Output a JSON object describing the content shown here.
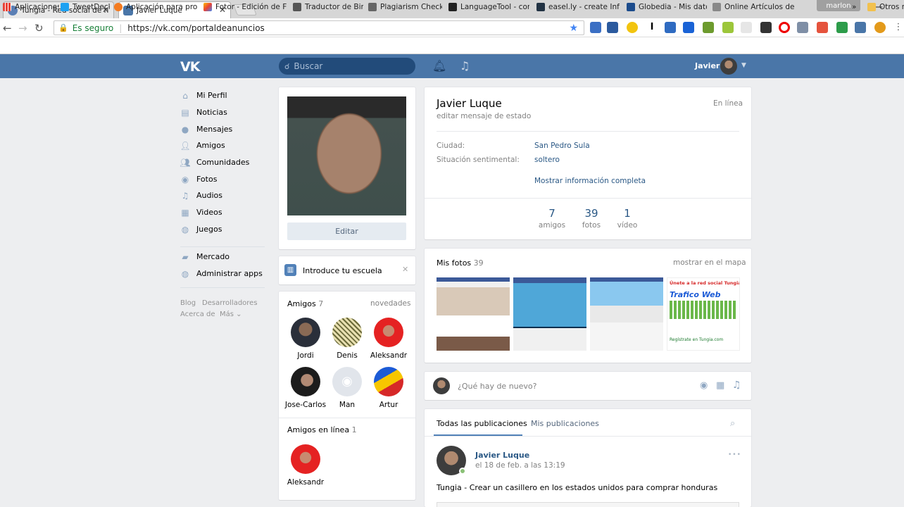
{
  "browser": {
    "tabs": [
      {
        "title": "Tungia - Red social de n",
        "close": "✕"
      },
      {
        "title": "Javier Luque",
        "close": "✕"
      }
    ],
    "user_badge": "marlon",
    "window_min": "—",
    "window_close": "✕",
    "secure_label": "Es seguro",
    "url": "https://vk.com/portaldeanuncios",
    "bookmarks": [
      "Aplicaciones",
      "TweetDeck",
      "Aplicación para progr",
      "Fotor - Edición de Fot",
      "Traductor de Bing",
      "Plagiarism Checker",
      "LanguageTool - corre",
      "easel.ly - create Infog",
      "Globedia - Mis datos",
      "Online Artículos de N"
    ],
    "bookmarks_more": "»",
    "other_bookmarks": "Otros m"
  },
  "vk": {
    "search_placeholder": "Buscar",
    "header_name": "Javier",
    "menu": [
      "Mi Perfil",
      "Noticias",
      "Mensajes",
      "Amigos",
      "Comunidades",
      "Fotos",
      "Audios",
      "Videos",
      "Juegos"
    ],
    "menu2": [
      "Mercado",
      "Administrar apps"
    ],
    "footer": [
      "Blog",
      "Desarrolladores",
      "Acerca de",
      "Más"
    ],
    "edit_button": "Editar",
    "school_prompt": "Introduce tu escuela",
    "friends_label": "Amigos",
    "friends_count": "7",
    "friends_updates": "novedades",
    "friends": [
      "Jordi",
      "Denis",
      "Aleksandr",
      "Jose-Carlos",
      "Man",
      "Artur"
    ],
    "online_label": "Amigos en línea",
    "online_count": "1",
    "online_friends": [
      "Aleksandr"
    ],
    "profile": {
      "name": "Javier Luque",
      "status_edit": "editar mensaje de estado",
      "online": "En línea",
      "city_label": "Ciudad:",
      "city": "San Pedro Sula",
      "relationship_label": "Situación sentimental:",
      "relationship": "soltero",
      "show_full": "Mostrar información completa",
      "counters": [
        {
          "value": "7",
          "label": "amigos"
        },
        {
          "value": "39",
          "label": "fotos"
        },
        {
          "value": "1",
          "label": "vídeo"
        }
      ]
    },
    "photos": {
      "label": "Mis fotos",
      "count": "39",
      "map_link": "mostrar en el mapa",
      "banner_title": "Únete a la red social Tungia",
      "banner_logo": "Trafico Web",
      "banner_cta": "Regístrate en Tungia.com"
    },
    "post_box": {
      "placeholder": "¿Qué hay de nuevo?"
    },
    "wall": {
      "tab_all": "Todas las publicaciones",
      "tab_mine": "Mis publicaciones",
      "post_author": "Javier Luque",
      "post_date": "el 18 de feb. a las 13:19",
      "post_more": "•••",
      "post_text": "Tungia - Crear un casillero en los estados unidos para comprar honduras"
    }
  }
}
